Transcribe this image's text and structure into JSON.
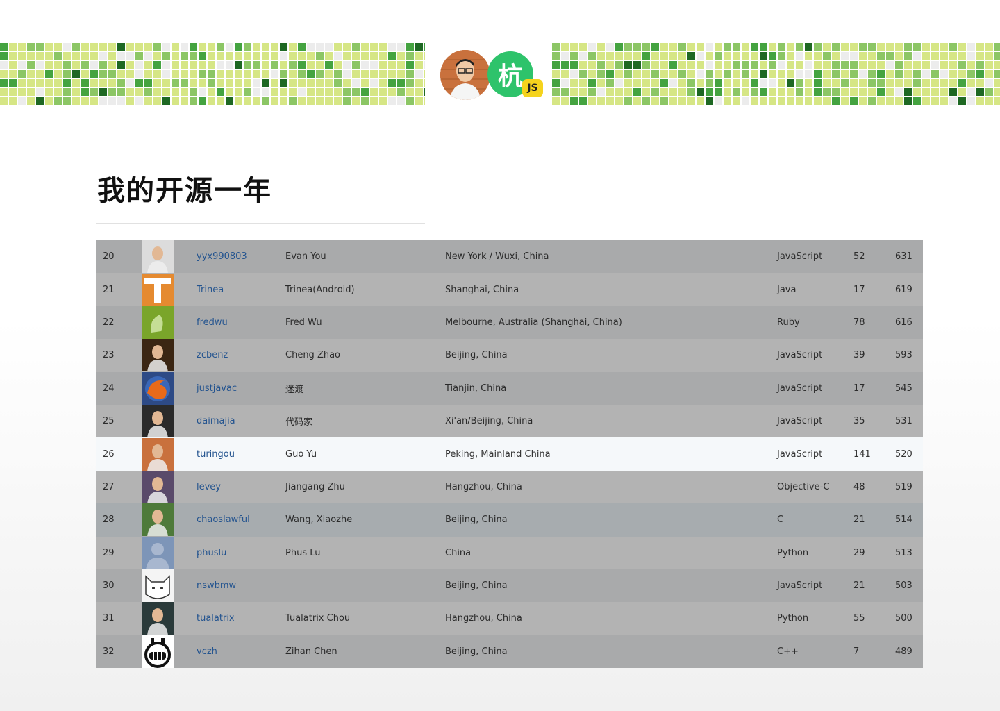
{
  "header": {
    "logo": {
      "hang_char": "杭",
      "badge_text": "JS",
      "avatar_icon": "person-photo-icon"
    }
  },
  "title": "我的开源一年",
  "colors": {
    "contrib_levels": [
      "#ececec",
      "#d6e685",
      "#8cc665",
      "#44a340",
      "#1e6823"
    ],
    "link": "#24548f",
    "row_dark": "#a9aaab",
    "row_light": "#b3b3b3",
    "row_highlight": "#f5f8fa",
    "hang_green": "#2ec36b",
    "js_yellow": "#f5d31d"
  },
  "users": [
    {
      "rank": "20",
      "login": "yyx990803",
      "name": "Evan You",
      "location": "New York / Wuxi, China",
      "language": "JavaScript",
      "repos": "52",
      "followers": "631",
      "avatar": "evan-avatar-icon",
      "avatar_bg": "#dcdcdc"
    },
    {
      "rank": "21",
      "login": "Trinea",
      "name": "Trinea(Android)",
      "location": "Shanghai, China",
      "language": "Java",
      "repos": "17",
      "followers": "619",
      "avatar": "trinea-t-logo-icon",
      "avatar_bg": "#e58a30"
    },
    {
      "rank": "22",
      "login": "fredwu",
      "name": "Fred Wu",
      "location": "Melbourne, Australia (Shanghai, China)",
      "language": "Ruby",
      "repos": "78",
      "followers": "616",
      "avatar": "fredwu-green-avatar-icon",
      "avatar_bg": "#7aa52a"
    },
    {
      "rank": "23",
      "login": "zcbenz",
      "name": "Cheng Zhao",
      "location": "Beijing, China",
      "language": "JavaScript",
      "repos": "39",
      "followers": "593",
      "avatar": "zcbenz-photo-icon",
      "avatar_bg": "#3b2613"
    },
    {
      "rank": "24",
      "login": "justjavac",
      "name": "迷渡",
      "location": "Tianjin, China",
      "language": "JavaScript",
      "repos": "17",
      "followers": "545",
      "avatar": "firefox-logo-icon",
      "avatar_bg": "#2d4a86"
    },
    {
      "rank": "25",
      "login": "daimajia",
      "name": "代码家",
      "location": "Xi'an/Beijing, China",
      "language": "JavaScript",
      "repos": "35",
      "followers": "531",
      "avatar": "daimajia-bw-photo-icon",
      "avatar_bg": "#2a2a2a"
    },
    {
      "rank": "26",
      "login": "turingou",
      "name": "Guo Yu",
      "location": "Peking, Mainland China",
      "language": "JavaScript",
      "repos": "141",
      "followers": "520",
      "avatar": "turingou-photo-icon",
      "avatar_bg": "#c9713d"
    },
    {
      "rank": "27",
      "login": "levey",
      "name": "Jiangang Zhu",
      "location": "Hangzhou, China",
      "language": "Objective-C",
      "repos": "48",
      "followers": "519",
      "avatar": "levey-gundam-icon",
      "avatar_bg": "#5a4a6a"
    },
    {
      "rank": "28",
      "login": "chaoslawful",
      "name": "Wang, Xiaozhe",
      "location": "Beijing, China",
      "language": "C",
      "repos": "21",
      "followers": "514",
      "avatar": "chaoslawful-cat-icon",
      "avatar_bg": "#4e7a3a"
    },
    {
      "rank": "29",
      "login": "phuslu",
      "name": "Phus Lu",
      "location": "China",
      "language": "Python",
      "repos": "29",
      "followers": "513",
      "avatar": "default-person-silhouette-icon",
      "avatar_bg": "#7d95b8"
    },
    {
      "rank": "30",
      "login": "nswbmw",
      "name": "",
      "location": "Beijing, China",
      "language": "JavaScript",
      "repos": "21",
      "followers": "503",
      "avatar": "cartoon-cat-icon",
      "avatar_bg": "#f4f4f4"
    },
    {
      "rank": "31",
      "login": "tualatrix",
      "name": "Tualatrix Chou",
      "location": "Hangzhou, China",
      "language": "Python",
      "repos": "55",
      "followers": "500",
      "avatar": "tualatrix-photo-icon",
      "avatar_bg": "#2a3a3a"
    },
    {
      "rank": "32",
      "login": "vczh",
      "name": "Zihan Chen",
      "location": "Beijing, China",
      "language": "C++",
      "repos": "7",
      "followers": "489",
      "avatar": "grinning-face-icon",
      "avatar_bg": "#ffffff"
    }
  ],
  "highlight_rank": "26",
  "blue_rank": "28"
}
